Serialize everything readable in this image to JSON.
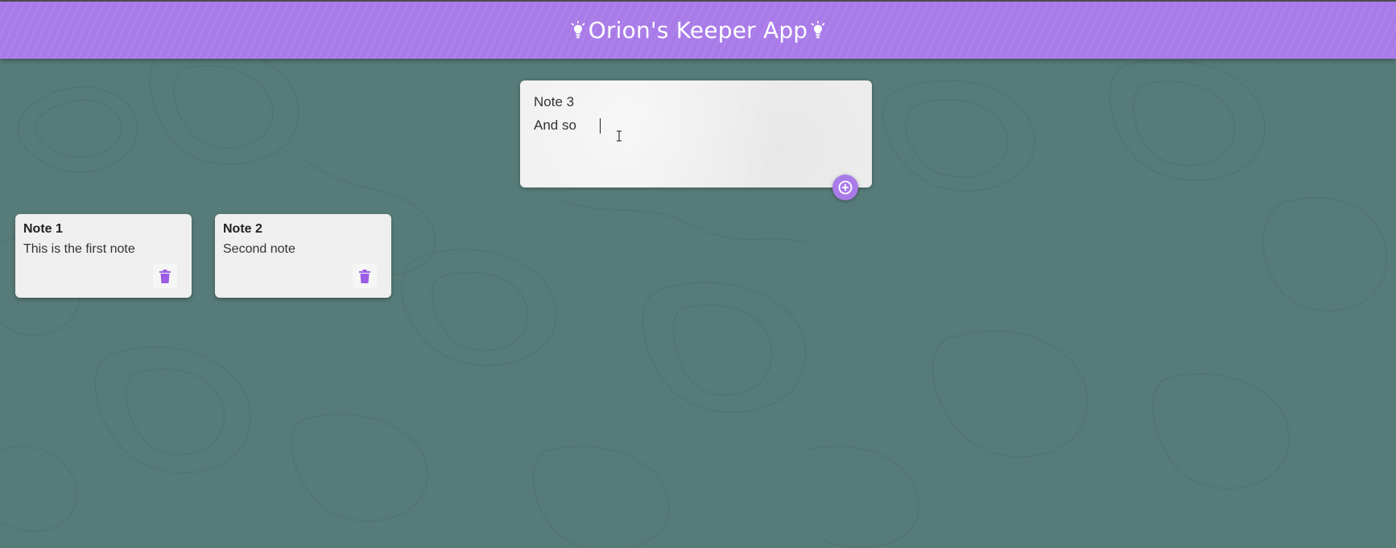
{
  "header": {
    "title": "Orion's Keeper App"
  },
  "create_note": {
    "title_value": "Note 3",
    "content_value": "And so"
  },
  "notes": [
    {
      "title": "Note 1",
      "content": "This is the first note"
    },
    {
      "title": "Note 2",
      "content": "Second note"
    }
  ],
  "colors": {
    "accent": "#a97be8",
    "background": "#577b78",
    "card": "#efefef",
    "delete_icon": "#9b5de5"
  },
  "icons": {
    "header_left": "lightbulb-icon",
    "header_right": "lightbulb-icon",
    "add": "plus-circle-icon",
    "delete": "trash-icon"
  }
}
